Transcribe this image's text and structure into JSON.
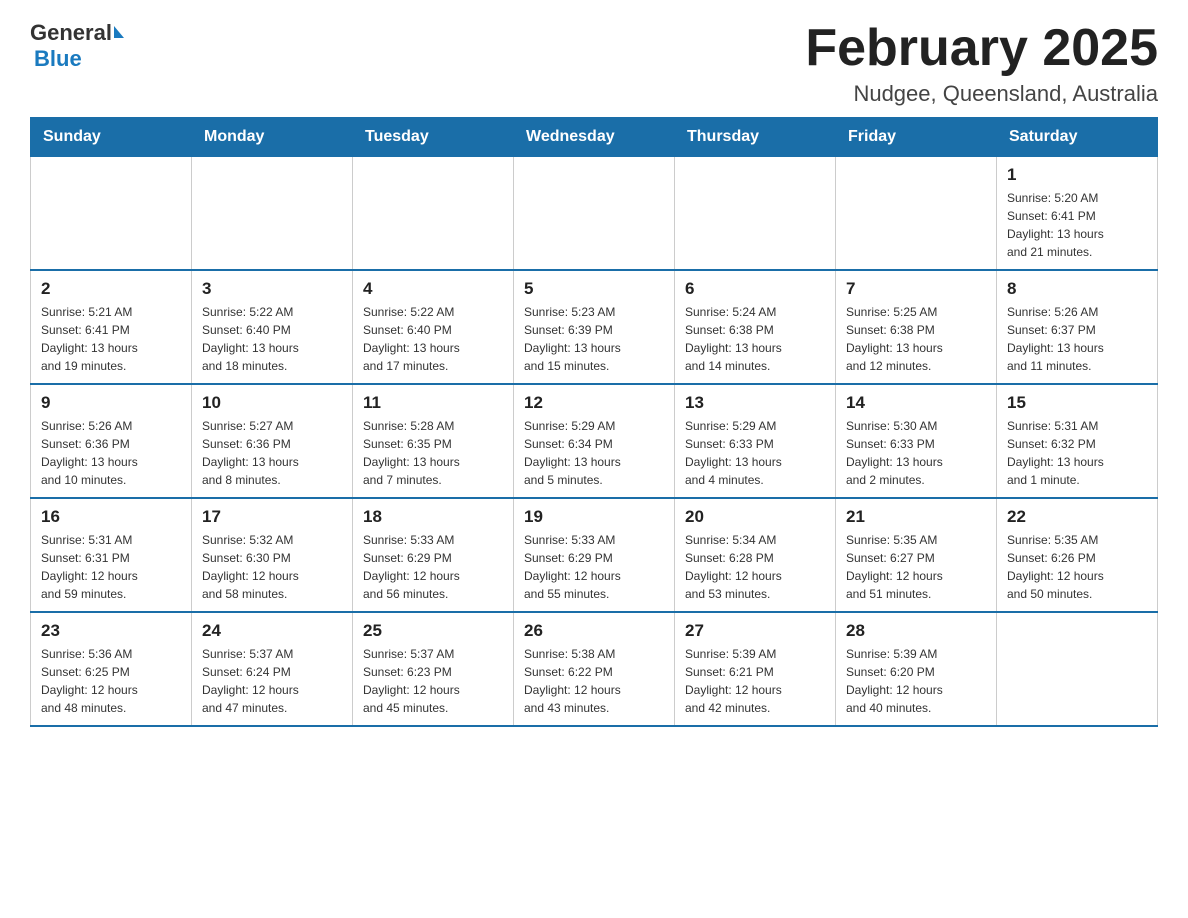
{
  "logo": {
    "general": "General",
    "blue": "Blue"
  },
  "title": "February 2025",
  "subtitle": "Nudgee, Queensland, Australia",
  "weekdays": [
    "Sunday",
    "Monday",
    "Tuesday",
    "Wednesday",
    "Thursday",
    "Friday",
    "Saturday"
  ],
  "weeks": [
    [
      {
        "day": "",
        "info": ""
      },
      {
        "day": "",
        "info": ""
      },
      {
        "day": "",
        "info": ""
      },
      {
        "day": "",
        "info": ""
      },
      {
        "day": "",
        "info": ""
      },
      {
        "day": "",
        "info": ""
      },
      {
        "day": "1",
        "info": "Sunrise: 5:20 AM\nSunset: 6:41 PM\nDaylight: 13 hours\nand 21 minutes."
      }
    ],
    [
      {
        "day": "2",
        "info": "Sunrise: 5:21 AM\nSunset: 6:41 PM\nDaylight: 13 hours\nand 19 minutes."
      },
      {
        "day": "3",
        "info": "Sunrise: 5:22 AM\nSunset: 6:40 PM\nDaylight: 13 hours\nand 18 minutes."
      },
      {
        "day": "4",
        "info": "Sunrise: 5:22 AM\nSunset: 6:40 PM\nDaylight: 13 hours\nand 17 minutes."
      },
      {
        "day": "5",
        "info": "Sunrise: 5:23 AM\nSunset: 6:39 PM\nDaylight: 13 hours\nand 15 minutes."
      },
      {
        "day": "6",
        "info": "Sunrise: 5:24 AM\nSunset: 6:38 PM\nDaylight: 13 hours\nand 14 minutes."
      },
      {
        "day": "7",
        "info": "Sunrise: 5:25 AM\nSunset: 6:38 PM\nDaylight: 13 hours\nand 12 minutes."
      },
      {
        "day": "8",
        "info": "Sunrise: 5:26 AM\nSunset: 6:37 PM\nDaylight: 13 hours\nand 11 minutes."
      }
    ],
    [
      {
        "day": "9",
        "info": "Sunrise: 5:26 AM\nSunset: 6:36 PM\nDaylight: 13 hours\nand 10 minutes."
      },
      {
        "day": "10",
        "info": "Sunrise: 5:27 AM\nSunset: 6:36 PM\nDaylight: 13 hours\nand 8 minutes."
      },
      {
        "day": "11",
        "info": "Sunrise: 5:28 AM\nSunset: 6:35 PM\nDaylight: 13 hours\nand 7 minutes."
      },
      {
        "day": "12",
        "info": "Sunrise: 5:29 AM\nSunset: 6:34 PM\nDaylight: 13 hours\nand 5 minutes."
      },
      {
        "day": "13",
        "info": "Sunrise: 5:29 AM\nSunset: 6:33 PM\nDaylight: 13 hours\nand 4 minutes."
      },
      {
        "day": "14",
        "info": "Sunrise: 5:30 AM\nSunset: 6:33 PM\nDaylight: 13 hours\nand 2 minutes."
      },
      {
        "day": "15",
        "info": "Sunrise: 5:31 AM\nSunset: 6:32 PM\nDaylight: 13 hours\nand 1 minute."
      }
    ],
    [
      {
        "day": "16",
        "info": "Sunrise: 5:31 AM\nSunset: 6:31 PM\nDaylight: 12 hours\nand 59 minutes."
      },
      {
        "day": "17",
        "info": "Sunrise: 5:32 AM\nSunset: 6:30 PM\nDaylight: 12 hours\nand 58 minutes."
      },
      {
        "day": "18",
        "info": "Sunrise: 5:33 AM\nSunset: 6:29 PM\nDaylight: 12 hours\nand 56 minutes."
      },
      {
        "day": "19",
        "info": "Sunrise: 5:33 AM\nSunset: 6:29 PM\nDaylight: 12 hours\nand 55 minutes."
      },
      {
        "day": "20",
        "info": "Sunrise: 5:34 AM\nSunset: 6:28 PM\nDaylight: 12 hours\nand 53 minutes."
      },
      {
        "day": "21",
        "info": "Sunrise: 5:35 AM\nSunset: 6:27 PM\nDaylight: 12 hours\nand 51 minutes."
      },
      {
        "day": "22",
        "info": "Sunrise: 5:35 AM\nSunset: 6:26 PM\nDaylight: 12 hours\nand 50 minutes."
      }
    ],
    [
      {
        "day": "23",
        "info": "Sunrise: 5:36 AM\nSunset: 6:25 PM\nDaylight: 12 hours\nand 48 minutes."
      },
      {
        "day": "24",
        "info": "Sunrise: 5:37 AM\nSunset: 6:24 PM\nDaylight: 12 hours\nand 47 minutes."
      },
      {
        "day": "25",
        "info": "Sunrise: 5:37 AM\nSunset: 6:23 PM\nDaylight: 12 hours\nand 45 minutes."
      },
      {
        "day": "26",
        "info": "Sunrise: 5:38 AM\nSunset: 6:22 PM\nDaylight: 12 hours\nand 43 minutes."
      },
      {
        "day": "27",
        "info": "Sunrise: 5:39 AM\nSunset: 6:21 PM\nDaylight: 12 hours\nand 42 minutes."
      },
      {
        "day": "28",
        "info": "Sunrise: 5:39 AM\nSunset: 6:20 PM\nDaylight: 12 hours\nand 40 minutes."
      },
      {
        "day": "",
        "info": ""
      }
    ]
  ]
}
